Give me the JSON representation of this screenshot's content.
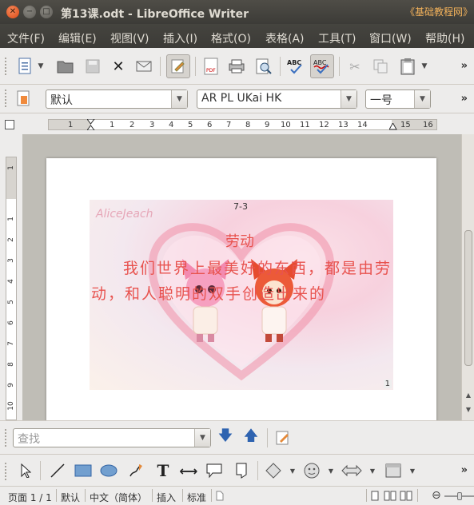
{
  "window": {
    "title": "第13课.odt - LibreOffice Writer",
    "watermark": "《基础教程网》"
  },
  "menu": [
    "文件(F)",
    "编辑(E)",
    "视图(V)",
    "插入(I)",
    "格式(O)",
    "表格(A)",
    "工具(T)",
    "窗口(W)",
    "帮助(H)"
  ],
  "format_toolbar": {
    "style": "默认",
    "font": "AR PL UKai HK",
    "size": "一号"
  },
  "ruler": {
    "h_numbers": [
      "1",
      "1",
      "2",
      "3",
      "4",
      "5",
      "6",
      "7",
      "8",
      "9",
      "10",
      "11",
      "12",
      "13",
      "14",
      "15",
      "16"
    ],
    "v_numbers": [
      "1",
      "1",
      "2",
      "3",
      "4",
      "5",
      "6",
      "7",
      "8",
      "9",
      "10"
    ]
  },
  "slide": {
    "number": "7-3",
    "corner_number": "1",
    "brand_text": "AliceJeach",
    "title": "劳动",
    "body": "我们世界上最美好的东西，都是由劳动，和人聪明的双手创造出来的"
  },
  "findbar": {
    "placeholder": "查找"
  },
  "status": {
    "page": "页面 1 / 1",
    "style": "默认",
    "language": "中文（简体）",
    "insert_mode": "插入",
    "selection_mode": "标准"
  },
  "colors": {
    "titlebar": "#3c3b37",
    "accent_close": "#dd4814",
    "poem_text": "#e8534f"
  }
}
